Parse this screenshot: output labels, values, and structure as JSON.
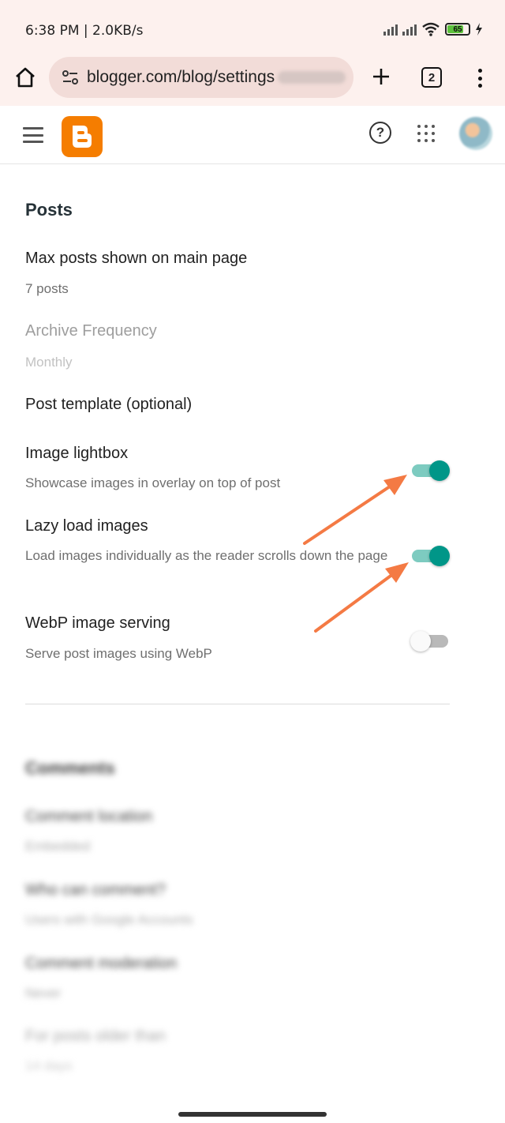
{
  "status_bar": {
    "time_speed": "6:38 PM | 2.0KB/s",
    "battery_level": "65",
    "icons": [
      "signal-icon",
      "signal-icon",
      "wifi-icon",
      "battery-icon",
      "charging-icon"
    ]
  },
  "browser": {
    "url": "blogger.com/blog/settings",
    "tab_count": "2",
    "icons": [
      "home-icon",
      "site-settings-icon",
      "plus-icon",
      "tabs-icon",
      "more-vert-icon"
    ]
  },
  "app_header": {
    "icons": [
      "hamburger-menu-icon",
      "blogger-logo",
      "help-icon",
      "apps-grid-icon",
      "avatar"
    ]
  },
  "posts_section": {
    "title": "Posts",
    "rows": [
      {
        "title": "Max posts shown on main page",
        "subtitle": "7 posts",
        "disabled": false
      },
      {
        "title": "Archive Frequency",
        "subtitle": "Monthly",
        "disabled": true
      },
      {
        "title": "Post template (optional)",
        "subtitle": "",
        "disabled": false
      },
      {
        "title": "Image lightbox",
        "subtitle": "Showcase images in overlay on top of post",
        "toggle": true
      },
      {
        "title": "Lazy load images",
        "subtitle": "Load images individually as the reader scrolls down the page",
        "toggle": true
      },
      {
        "title": "WebP image serving",
        "subtitle": "Serve post images using WebP",
        "toggle": false
      }
    ]
  },
  "comments_section": {
    "title": "Comments",
    "rows": [
      {
        "title": "Comment location",
        "subtitle": "Embedded"
      },
      {
        "title": "Who can comment?",
        "subtitle": "Users with Google Accounts"
      },
      {
        "title": "Comment moderation",
        "subtitle": "Never"
      },
      {
        "title": "For posts older than",
        "subtitle": "14 days"
      }
    ]
  },
  "colors": {
    "blogger_orange": "#f57d00",
    "toggle_on": "#009688",
    "annotation_arrow": "#f47a44"
  }
}
